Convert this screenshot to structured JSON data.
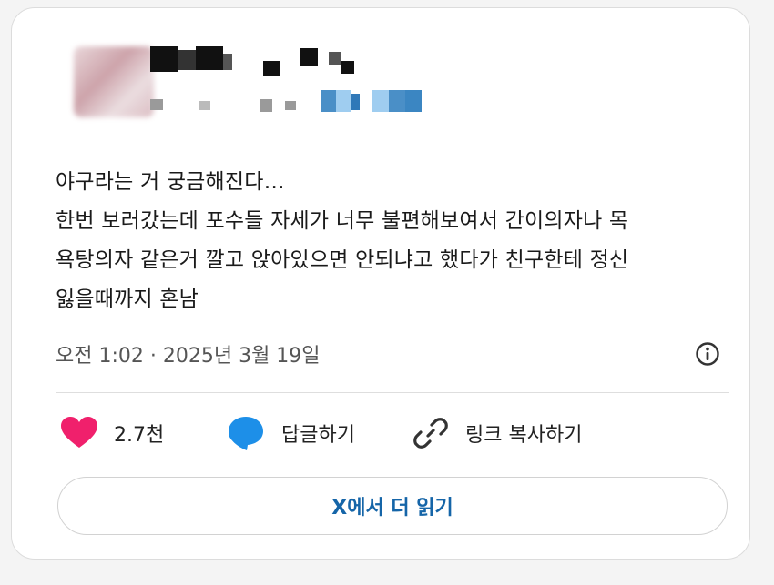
{
  "tweet": {
    "lines": [
      "야구라는 거 궁금해진다…",
      "한번 보러갔는데 포수들 자세가 너무 불편해보여서 간이의자나 목",
      "욕탕의자 같은거 깔고 앉아있으면 안되냐고 했다가 친구한테 정신",
      "잃을때까지 혼남"
    ],
    "timestamp": "오전 1:02 · 2025년 3월 19일"
  },
  "actions": {
    "like_count": "2.7천",
    "reply_label": "답글하기",
    "copy_link_label": "링크 복사하기"
  },
  "read_more_label": "X에서 더 읽기",
  "colors": {
    "like": "#f0206c",
    "reply": "#1d8fe8",
    "read_more_text": "#1565a8"
  },
  "icons": {
    "like": "heart-icon",
    "reply": "speech-bubble-icon",
    "copy": "link-icon",
    "info": "info-icon"
  }
}
